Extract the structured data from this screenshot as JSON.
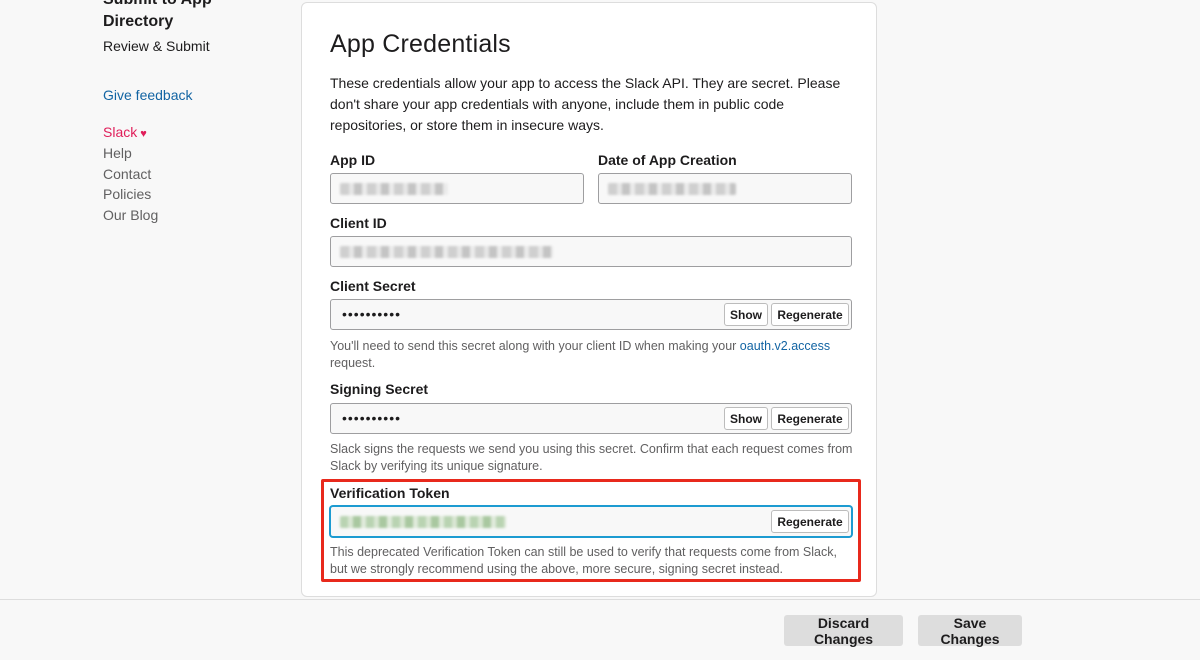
{
  "sidebar": {
    "heading": "Submit to App Directory",
    "review_submit": "Review & Submit",
    "give_feedback": "Give feedback",
    "slack": "Slack",
    "slack_heart": "♥",
    "help": "Help",
    "contact": "Contact",
    "policies": "Policies",
    "our_blog": "Our Blog"
  },
  "card": {
    "title": "App Credentials",
    "description": "These credentials allow your app to access the Slack API. They are secret. Please don't share your app credentials with anyone, include them in public code repositories, or store them in insecure ways.",
    "app_id": {
      "label": "App ID",
      "value_state": "blurred"
    },
    "date_created": {
      "label": "Date of App Creation",
      "value_state": "blurred"
    },
    "client_id": {
      "label": "Client ID",
      "value_state": "blurred"
    },
    "client_secret": {
      "label": "Client Secret",
      "masked_value": "••••••••••",
      "show_label": "Show",
      "regenerate_label": "Regenerate",
      "help_prefix": "You'll need to send this secret along with your client ID when making your ",
      "help_link": "oauth.v2.access",
      "help_suffix": " request."
    },
    "signing_secret": {
      "label": "Signing Secret",
      "masked_value": "••••••••••",
      "show_label": "Show",
      "regenerate_label": "Regenerate",
      "help": "Slack signs the requests we send you using this secret. Confirm that each request comes from Slack by verifying its unique signature."
    },
    "verification_token": {
      "label": "Verification Token",
      "value_state": "blurred",
      "regenerate_label": "Regenerate",
      "help": "This deprecated Verification Token can still be used to verify that requests come from Slack, but we strongly recommend using the above, more secure, signing secret instead."
    }
  },
  "footer": {
    "discard_label": "Discard Changes",
    "save_label": "Save Changes"
  },
  "colors": {
    "link": "#1264a3",
    "slack_pink": "#e01e5a",
    "highlight": "#e8291c",
    "focus": "#1d9bd1"
  }
}
